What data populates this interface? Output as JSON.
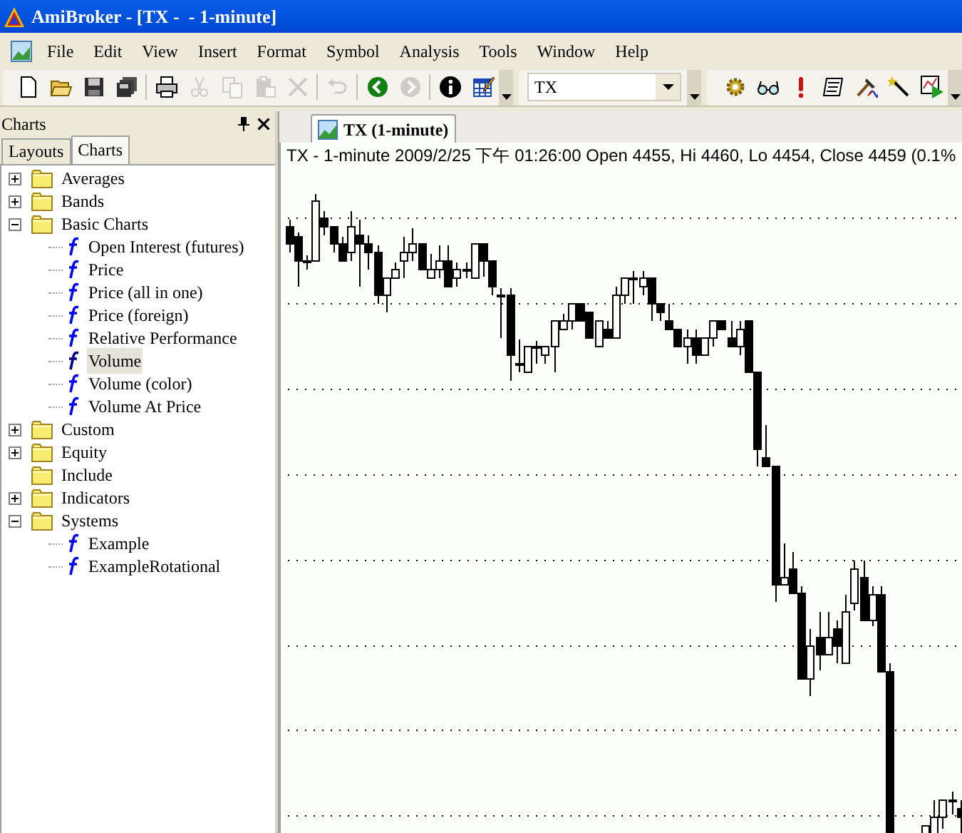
{
  "window": {
    "title": "AmiBroker - [TX -  - 1-minute]"
  },
  "menu": [
    "File",
    "Edit",
    "View",
    "Insert",
    "Format",
    "Symbol",
    "Analysis",
    "Tools",
    "Window",
    "Help"
  ],
  "toolbar": [
    {
      "kind": "new",
      "disabled": false
    },
    {
      "kind": "open",
      "disabled": false
    },
    {
      "kind": "save",
      "disabled": false
    },
    {
      "kind": "save-all",
      "disabled": false
    },
    {
      "kind": "sep"
    },
    {
      "kind": "print",
      "disabled": false
    },
    {
      "kind": "cut",
      "disabled": true
    },
    {
      "kind": "copy",
      "disabled": true
    },
    {
      "kind": "paste",
      "disabled": true
    },
    {
      "kind": "delete",
      "disabled": true
    },
    {
      "kind": "sep"
    },
    {
      "kind": "undo",
      "disabled": true
    },
    {
      "kind": "sep"
    },
    {
      "kind": "back",
      "disabled": false
    },
    {
      "kind": "forward",
      "disabled": true
    },
    {
      "kind": "sep"
    },
    {
      "kind": "info",
      "disabled": false
    },
    {
      "kind": "table-edit",
      "disabled": false
    }
  ],
  "symbol_combo": {
    "value": "TX"
  },
  "toolbar_2": [
    {
      "kind": "gear",
      "disabled": false
    },
    {
      "kind": "glasses",
      "disabled": false
    },
    {
      "kind": "exclamation",
      "disabled": false
    },
    {
      "kind": "scroll",
      "disabled": false
    },
    {
      "kind": "hammer",
      "disabled": false
    },
    {
      "kind": "wand",
      "disabled": false
    },
    {
      "kind": "chart-play",
      "disabled": false
    }
  ],
  "panel": {
    "title": "Charts",
    "tabs": [
      {
        "label": "Layouts",
        "selected": false
      },
      {
        "label": "Charts",
        "selected": true
      }
    ],
    "tree": [
      {
        "label": "Averages",
        "expanded": false,
        "selected": false
      },
      {
        "label": "Bands",
        "expanded": false,
        "selected": false
      },
      {
        "label": "Basic Charts",
        "expanded": true,
        "selected": false,
        "children": [
          {
            "label": "Open Interest (futures)",
            "selected": false
          },
          {
            "label": "Price",
            "selected": false
          },
          {
            "label": "Price (all in one)",
            "selected": false
          },
          {
            "label": "Price (foreign)",
            "selected": false
          },
          {
            "label": "Relative Performance",
            "selected": false
          },
          {
            "label": "Volume",
            "selected": true
          },
          {
            "label": "Volume (color)",
            "selected": false
          },
          {
            "label": "Volume At Price",
            "selected": false
          }
        ]
      },
      {
        "label": "Custom",
        "expanded": false,
        "selected": false
      },
      {
        "label": "Equity",
        "expanded": false,
        "selected": false
      },
      {
        "label": "Include",
        "selected": false
      },
      {
        "label": "Indicators",
        "expanded": false,
        "selected": false
      },
      {
        "label": "Systems",
        "expanded": true,
        "selected": false,
        "children": [
          {
            "label": "Example",
            "selected": false
          },
          {
            "label": "ExampleRotational",
            "selected": false
          }
        ]
      }
    ]
  },
  "chart_window": {
    "tab": {
      "label": "TX (1-minute)",
      "selected": true
    },
    "info": "TX - 1-minute 2009/2/25 下午 01:26:00 Open 4455, Hi 4460, Lo 4454, Close 4459 (0.1%"
  }
}
